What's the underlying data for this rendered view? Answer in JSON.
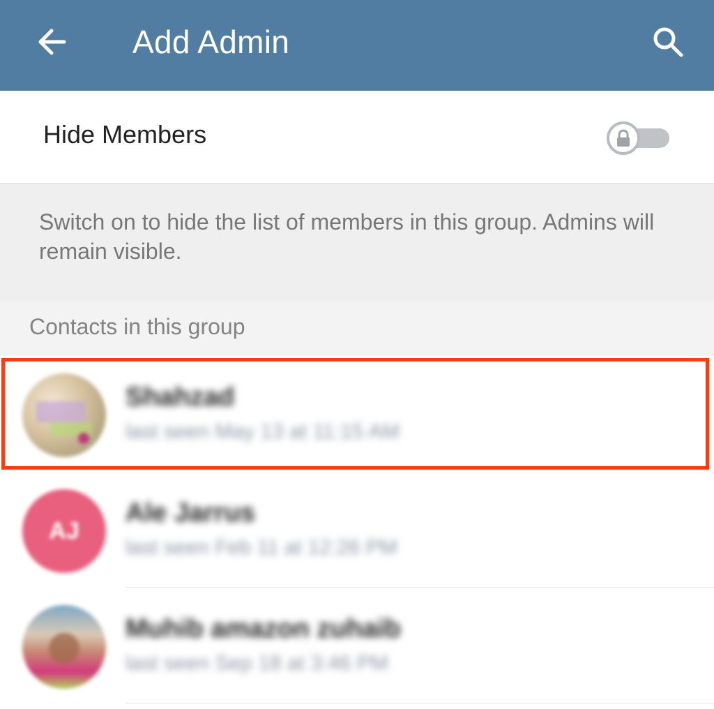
{
  "appbar": {
    "title": "Add Admin",
    "back_icon": "arrow-left-icon",
    "search_icon": "search-icon",
    "color": "#527da3"
  },
  "hide_members": {
    "label": "Hide Members",
    "enabled": false,
    "locked": true
  },
  "info": {
    "text": "Switch on to hide the list of members in this group. Admins will remain visible."
  },
  "section": {
    "title": "Contacts in this group"
  },
  "contacts": [
    {
      "name": "Shahzad",
      "status": "last seen May 13 at 11:15 AM",
      "avatar": "photo",
      "highlighted": true
    },
    {
      "name": "Ale Jarrus",
      "status": "last seen Feb 11 at 12:26 PM",
      "avatar": "initials",
      "initials": "AJ",
      "avatar_color": "#e8607e"
    },
    {
      "name": "Muhib amazon zuhaib",
      "status": "last seen Sep 18 at 3:46 PM",
      "avatar": "photo"
    }
  ],
  "highlight_color": "#ff3b14"
}
